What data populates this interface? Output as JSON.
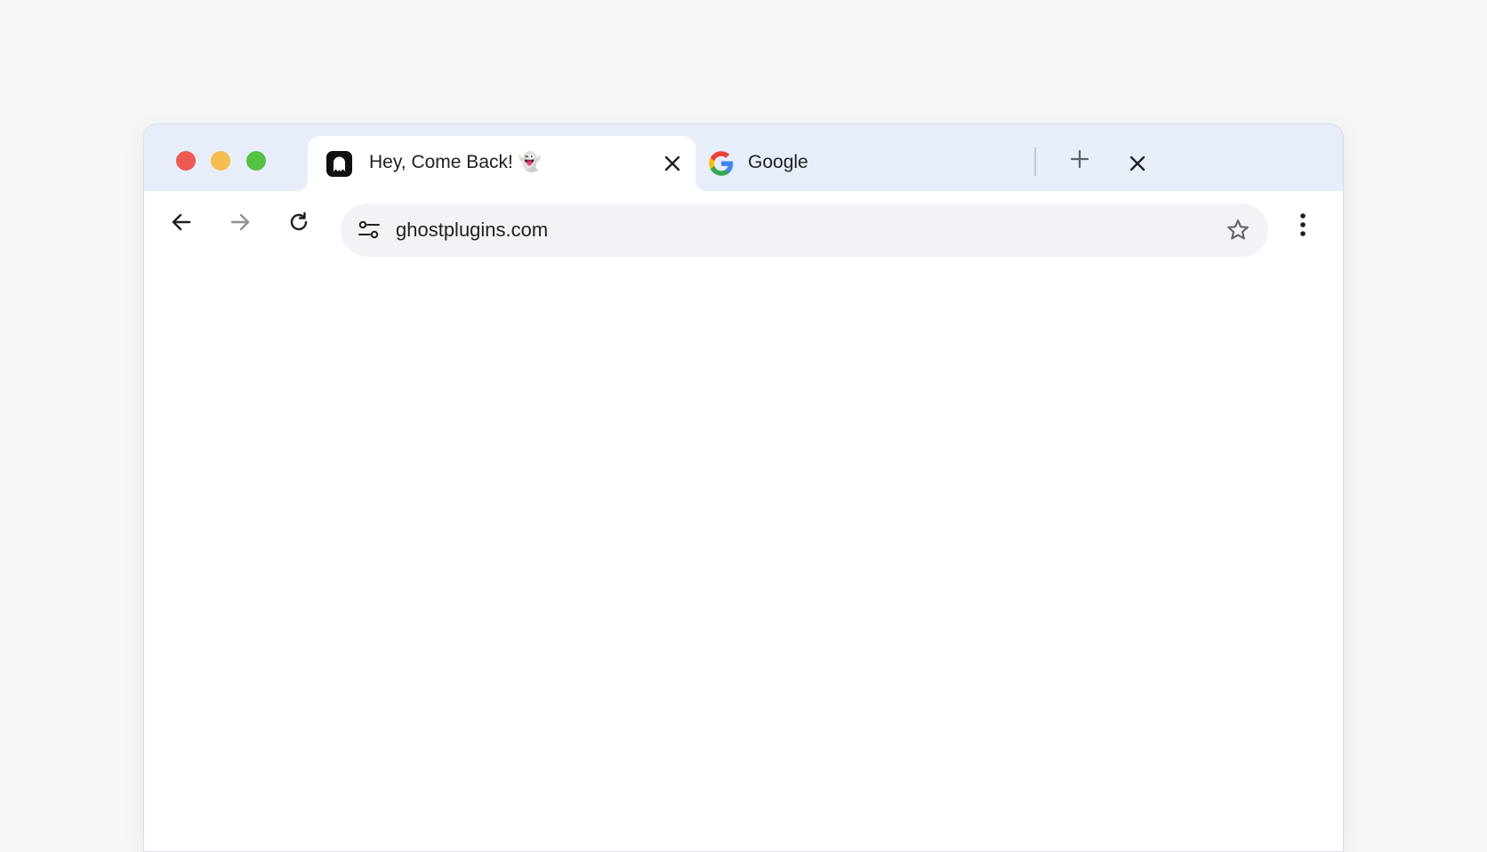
{
  "window": {
    "traffic_lights": [
      {
        "name": "close",
        "color": "#ee5a52"
      },
      {
        "name": "minimize",
        "color": "#f6bd4f"
      },
      {
        "name": "zoom",
        "color": "#55c140"
      }
    ]
  },
  "tabs": [
    {
      "title": "Hey, Come Back! 👻",
      "favicon": "ghost-icon",
      "active": true,
      "close_icon": "close-icon"
    },
    {
      "title": "Google",
      "favicon": "google-g-icon",
      "active": false,
      "close_icon": "close-icon"
    }
  ],
  "new_tab_icon": "plus-icon",
  "toolbar": {
    "back_icon": "arrow-left-icon",
    "forward_icon": "arrow-right-icon",
    "forward_enabled": false,
    "reload_icon": "reload-icon",
    "site_info_icon": "tune-icon",
    "url": "ghostplugins.com",
    "bookmark_icon": "star-outline-icon",
    "menu_icon": "kebab-menu-icon"
  },
  "colors": {
    "tabstrip": "#e7edf9",
    "omnibox": "#f1f3f6",
    "page_background": "#f6f6f6"
  }
}
